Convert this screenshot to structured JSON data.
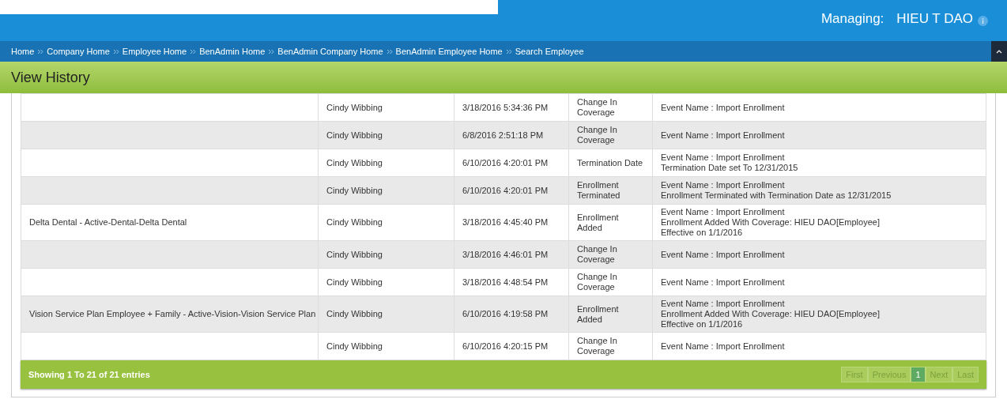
{
  "header": {
    "managing_label": "Managing:",
    "managing_name": "HIEU T DAO"
  },
  "breadcrumbs": [
    "Home",
    "Company Home",
    "Employee Home",
    "BenAdmin Home",
    "BenAdmin Company Home",
    "BenAdmin Employee Home",
    "Search Employee"
  ],
  "page_title": "View History",
  "table": {
    "rows": [
      {
        "plan": "",
        "user": "Cindy Wibbing",
        "date": "3/18/2016 5:34:36 PM",
        "action": "Change In Coverage",
        "details": [
          "Event Name : Import Enrollment"
        ]
      },
      {
        "plan": "",
        "user": "Cindy Wibbing",
        "date": "6/8/2016 2:51:18 PM",
        "action": "Change In Coverage",
        "details": [
          "Event Name : Import Enrollment"
        ]
      },
      {
        "plan": "",
        "user": "Cindy Wibbing",
        "date": "6/10/2016 4:20:01 PM",
        "action": "Termination Date",
        "details": [
          "Event Name : Import Enrollment",
          "Termination Date set To 12/31/2015"
        ]
      },
      {
        "plan": "",
        "user": "Cindy Wibbing",
        "date": "6/10/2016 4:20:01 PM",
        "action": "Enrollment Terminated",
        "details": [
          "Event Name : Import Enrollment",
          "Enrollment Terminated with Termination Date as 12/31/2015"
        ]
      },
      {
        "plan": "Delta Dental - Active-Dental-Delta Dental",
        "user": "Cindy Wibbing",
        "date": "3/18/2016 4:45:40 PM",
        "action": "Enrollment Added",
        "details": [
          "Event Name : Import Enrollment",
          "Enrollment Added With Coverage: HIEU DAO[Employee]",
          "Effective on 1/1/2016"
        ]
      },
      {
        "plan": "",
        "user": "Cindy Wibbing",
        "date": "3/18/2016 4:46:01 PM",
        "action": "Change In Coverage",
        "details": [
          "Event Name : Import Enrollment"
        ]
      },
      {
        "plan": "",
        "user": "Cindy Wibbing",
        "date": "3/18/2016 4:48:54 PM",
        "action": "Change In Coverage",
        "details": [
          "Event Name : Import Enrollment"
        ]
      },
      {
        "plan": "Vision Service Plan Employee + Family - Active-Vision-Vision Service Plan",
        "user": "Cindy Wibbing",
        "date": "6/10/2016 4:19:58 PM",
        "action": "Enrollment Added",
        "details": [
          "Event Name : Import Enrollment",
          "Enrollment Added With Coverage: HIEU DAO[Employee]",
          "Effective on 1/1/2016"
        ]
      },
      {
        "plan": "",
        "user": "Cindy Wibbing",
        "date": "6/10/2016 4:20:15 PM",
        "action": "Change In Coverage",
        "details": [
          "Event Name : Import Enrollment"
        ]
      }
    ]
  },
  "footer": {
    "summary": "Showing 1 To 21 of 21 entries",
    "pages": [
      {
        "label": "First",
        "selected": false,
        "disabled": true
      },
      {
        "label": "Previous",
        "selected": false,
        "disabled": true
      },
      {
        "label": "1",
        "selected": true,
        "disabled": false
      },
      {
        "label": "Next",
        "selected": false,
        "disabled": true
      },
      {
        "label": "Last",
        "selected": false,
        "disabled": true
      }
    ]
  }
}
